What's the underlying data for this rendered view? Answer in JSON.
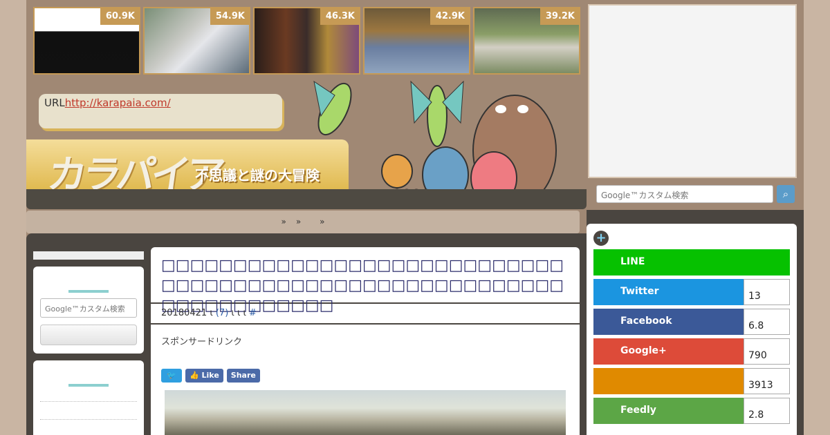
{
  "thumbs": [
    {
      "count": "60.9K"
    },
    {
      "count": "54.9K"
    },
    {
      "count": "46.3K"
    },
    {
      "count": "42.9K"
    },
    {
      "count": "39.2K"
    }
  ],
  "site": {
    "url_label": "URL",
    "url": "http://karapaia.com/",
    "logo": "カラパイア",
    "tagline": "不思議と謎の大冒険"
  },
  "nav": {
    "items": [
      "»",
      "»",
      "»"
    ]
  },
  "search": {
    "placeholder": "Google™カスタム検索"
  },
  "article": {
    "title": "□□□□□□□□□□□□□□□□□□□□□□□□□□□□□□□□□□□□□□□□□□□□□□□□□□□□□□□□□□□□□□□□□□□□",
    "date": "20180421",
    "comments": "(7)",
    "meta_rest": "ι ι ι",
    "hash": "#",
    "sponsor": "スポンサードリンク",
    "share_like": "Like",
    "share_share": "Share"
  },
  "social": [
    {
      "name": "LINE",
      "count": "",
      "color": "#06c100"
    },
    {
      "name": "Twitter",
      "count": "13",
      "color": "#1b95e0"
    },
    {
      "name": "Facebook",
      "count": "6.8",
      "color": "#3b5998"
    },
    {
      "name": "Google+",
      "count": "790",
      "color": "#dd4b39"
    },
    {
      "name": "",
      "count": "3913",
      "color": "#e08a00"
    },
    {
      "name": "Feedly",
      "count": "2.8",
      "color": "#5ca646"
    }
  ]
}
